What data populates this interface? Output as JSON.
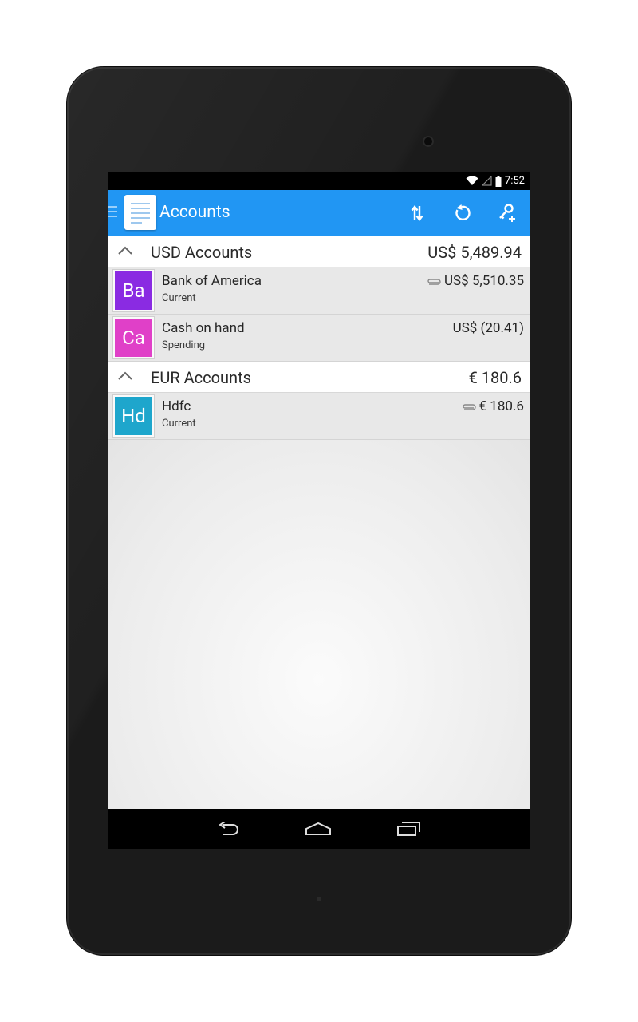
{
  "status_bar": {
    "time": "7:52"
  },
  "action_bar": {
    "title": "Accounts",
    "actions": [
      "sort-icon",
      "refresh-icon",
      "add-account-key-icon"
    ]
  },
  "sections": [
    {
      "title": "USD Accounts",
      "total": "US$ 5,489.94",
      "accounts": [
        {
          "initials": "Ba",
          "name": "Bank of America",
          "type": "Current",
          "balance": "US$ 5,510.35",
          "attachment": true,
          "color": "#8a2be2"
        },
        {
          "initials": "Ca",
          "name": "Cash on hand",
          "type": "Spending",
          "balance": "US$ (20.41)",
          "attachment": false,
          "color": "#e040c8"
        }
      ]
    },
    {
      "title": "EUR Accounts",
      "total": "€ 180.6",
      "accounts": [
        {
          "initials": "Hd",
          "name": "Hdfc",
          "type": "Current",
          "balance": "€ 180.6",
          "attachment": true,
          "color": "#1ea6cc"
        }
      ]
    }
  ],
  "nav_bar": {
    "buttons": [
      "back-icon",
      "home-icon",
      "recents-icon"
    ]
  },
  "colors": {
    "accent": "#2196f3",
    "list_bg": "#e8e8e8",
    "nav_bg": "#000000"
  }
}
